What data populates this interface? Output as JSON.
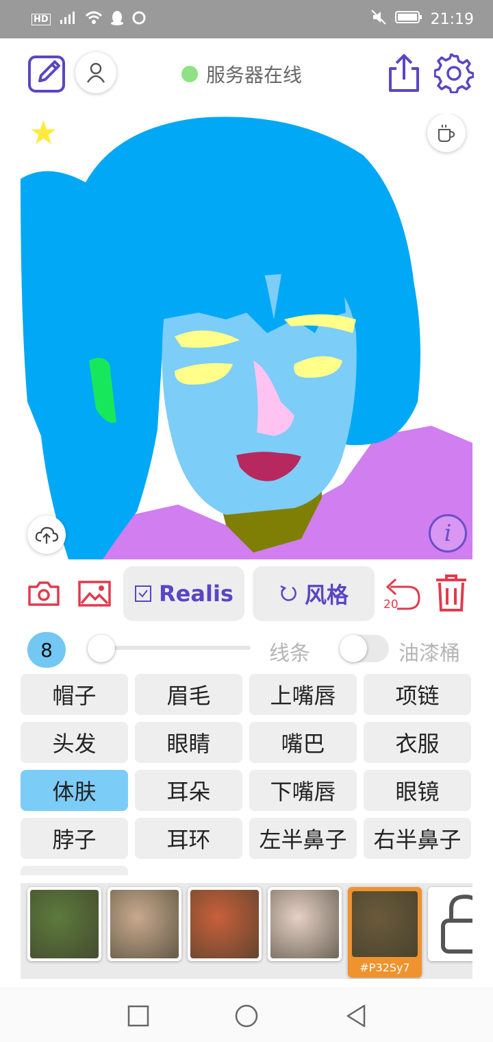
{
  "status_bar": {
    "left_icons": [
      "hd-icon",
      "signal-4g-icon",
      "wifi-icon",
      "qq-icon",
      "app-icon"
    ],
    "time": "21:19"
  },
  "header": {
    "server_status": "服务器在线",
    "status_color": "#8ee283",
    "accent": "#5a45c4"
  },
  "canvas": {
    "palette": {
      "hair": "#00a8f5",
      "skin": "#7ccdf8",
      "eyebrows": "#ffff8a",
      "ear": "#17e85b",
      "nose": "#ffc3f2",
      "lips": "#b7285f",
      "neck": "#7f7f06",
      "clothes": "#d07ef0"
    }
  },
  "toolbar": {
    "model_label": "Realis",
    "style_label": "风格",
    "undo_count": "20"
  },
  "brush": {
    "size": "8",
    "line_label": "线条",
    "bucket_label": "油漆桶",
    "bucket_enabled": false
  },
  "labels": [
    "帽子",
    "眉毛",
    "上嘴唇",
    "项链",
    "头发",
    "眼睛",
    "嘴巴",
    "衣服",
    "体肤",
    "耳朵",
    "下嘴唇",
    "眼镜",
    "脖子",
    "耳环",
    "左半鼻子",
    "右半鼻子"
  ],
  "active_label": "体肤",
  "styles": {
    "selected_code": "#P32Sy7",
    "swatch_colors": [
      "#5d7a3c",
      "#c8a98d",
      "#c8603a",
      "#e7d0c6",
      "#6b5a3a"
    ]
  }
}
